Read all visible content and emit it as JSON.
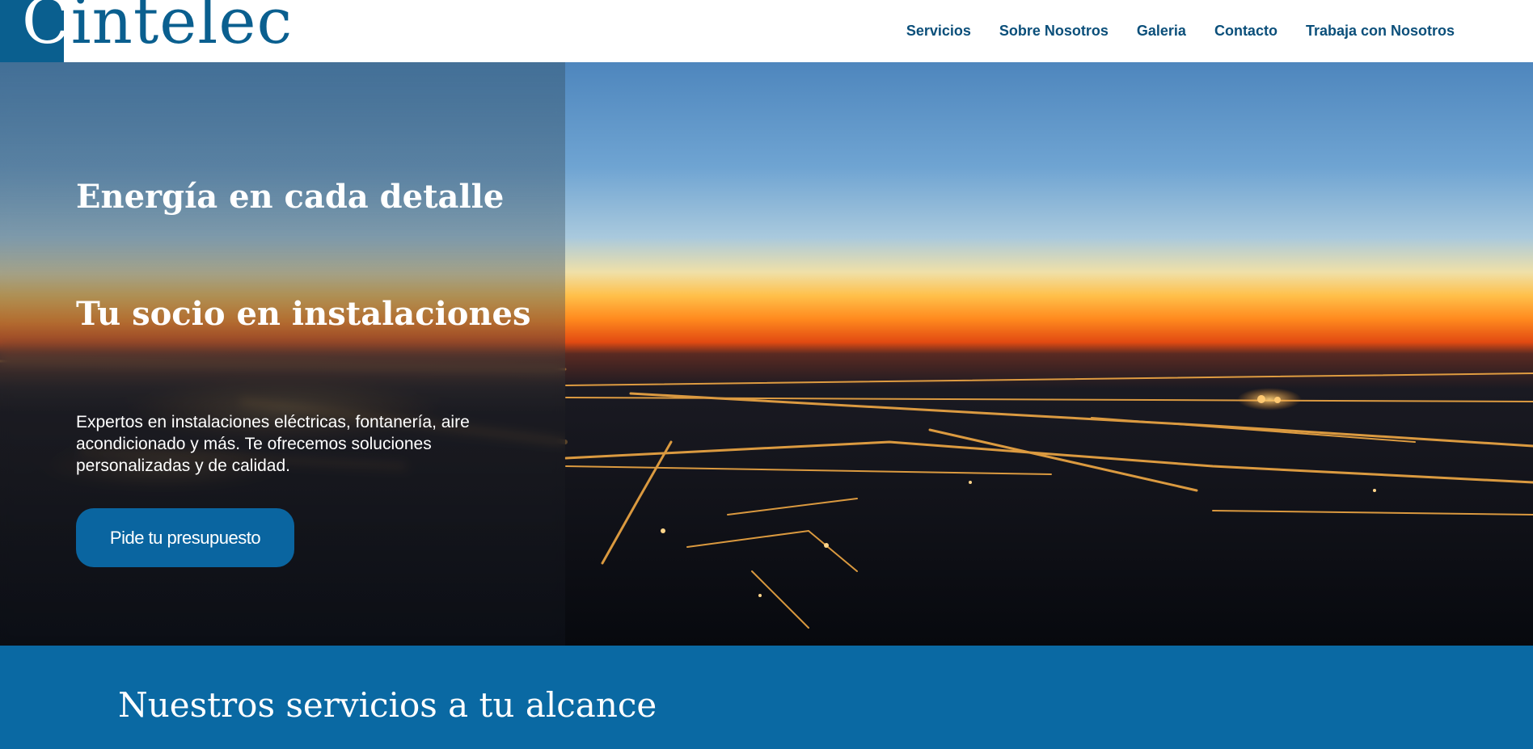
{
  "brand": {
    "logo_text": "Cintelec",
    "logo_first_letter": "C",
    "logo_rest": "intelec",
    "color": "#0a5f8f"
  },
  "nav": {
    "items": [
      {
        "label": "Servicios"
      },
      {
        "label": "Sobre Nosotros"
      },
      {
        "label": "Galeria"
      },
      {
        "label": "Contacto"
      },
      {
        "label": "Trabaja con Nosotros"
      }
    ],
    "color": "#0b4f7a"
  },
  "hero": {
    "title": "Energía en cada detalle",
    "subtitle": "Tu socio en instalaciones",
    "description": "Expertos en instalaciones eléctricas, fontanería, aire acondicionado y más. Te ofrecemos soluciones personalizadas y de calidad.",
    "cta_label": "Pide tu presupuesto",
    "cta_color": "#0a65a0",
    "background": "city-lights-at-dusk-image"
  },
  "services": {
    "title": "Nuestros servicios a tu alcance",
    "band_color": "#0a69a3"
  }
}
